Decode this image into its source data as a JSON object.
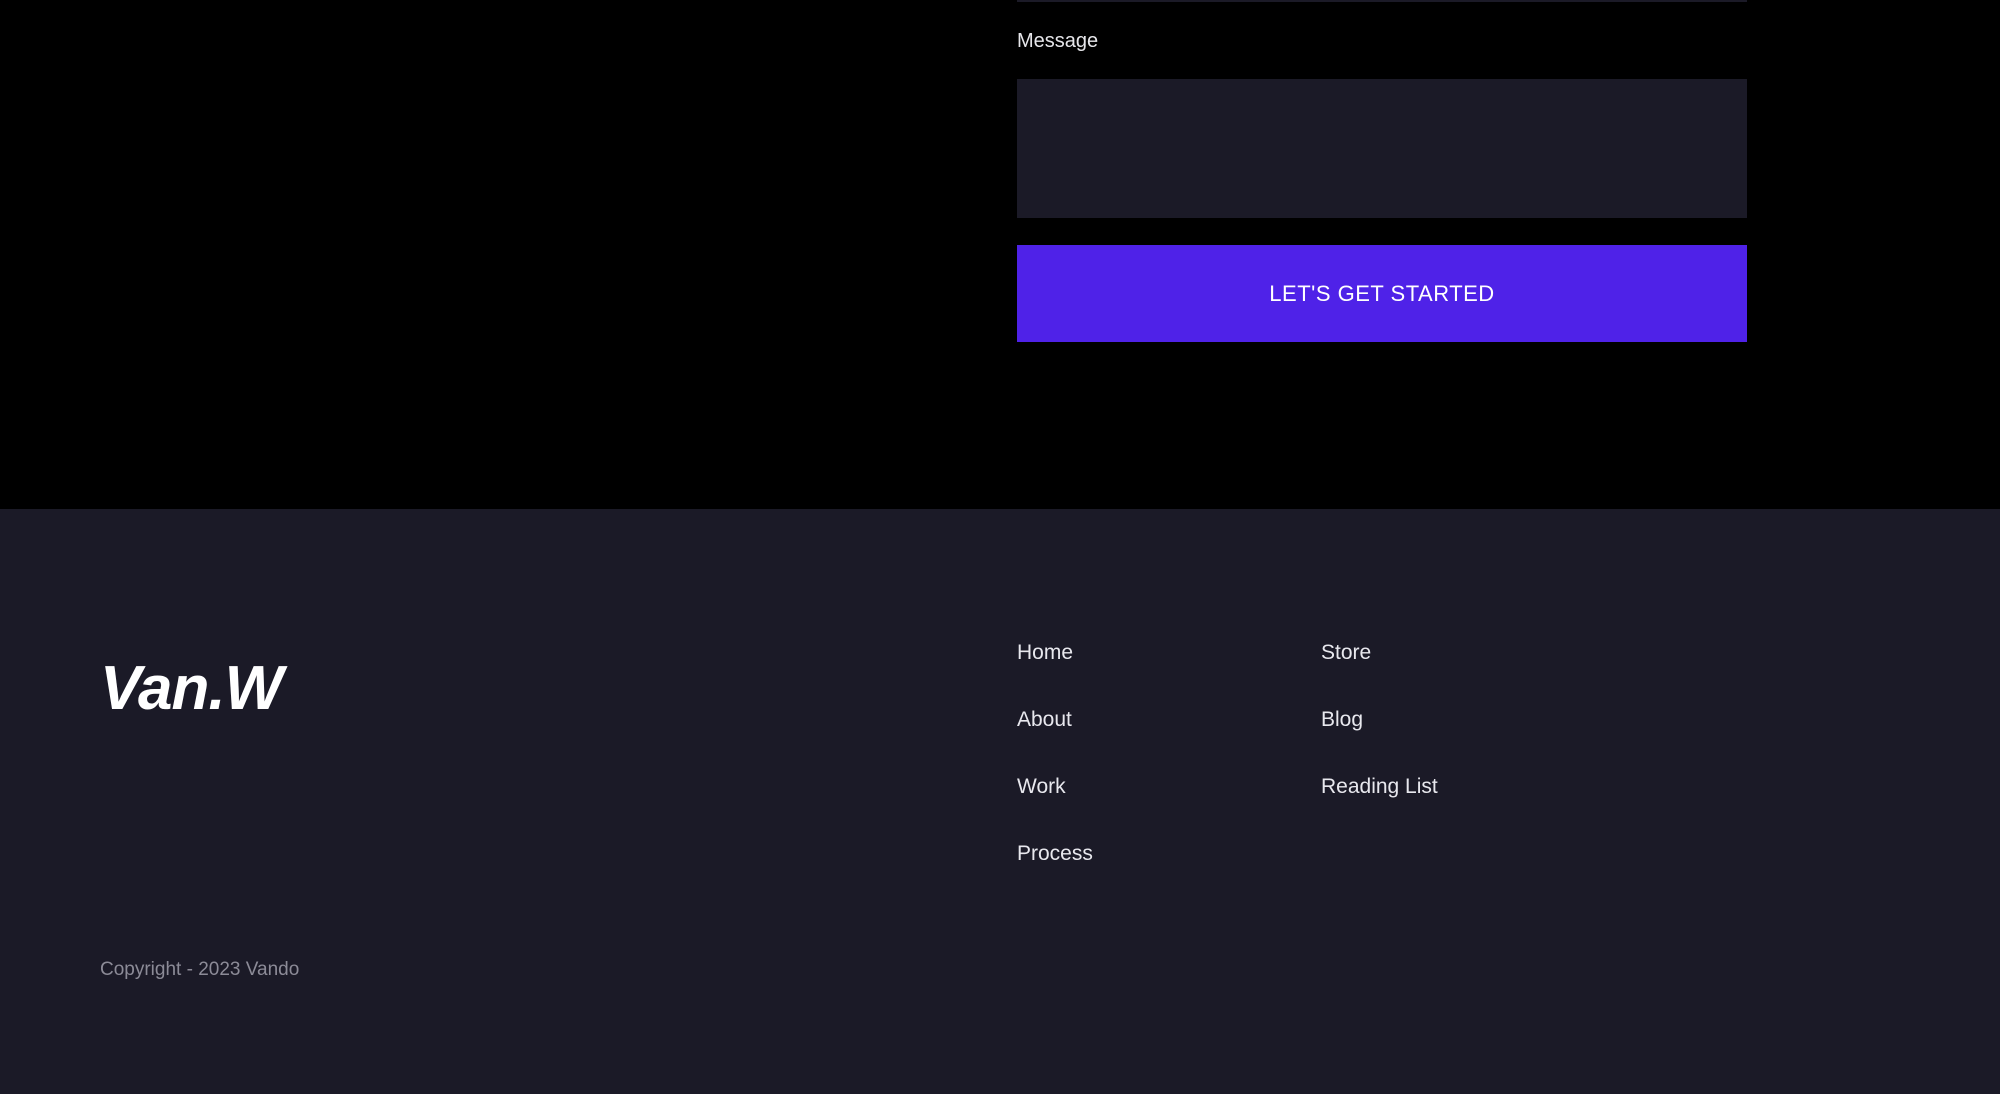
{
  "contact_form": {
    "message_label": "Message",
    "message_value": "",
    "submit_label": "LET'S GET STARTED"
  },
  "footer": {
    "logo_text": "Van.W",
    "nav_column_1": [
      "Home",
      "About",
      "Work",
      "Process"
    ],
    "nav_column_2": [
      "Store",
      "Blog",
      "Reading List"
    ],
    "copyright": "Copyright - 2023 Vando"
  },
  "colors": {
    "page_background": "#000000",
    "footer_background": "#1b1a27",
    "field_background": "#1b1a27",
    "accent": "#4f22e8",
    "text": "#ffffff"
  }
}
